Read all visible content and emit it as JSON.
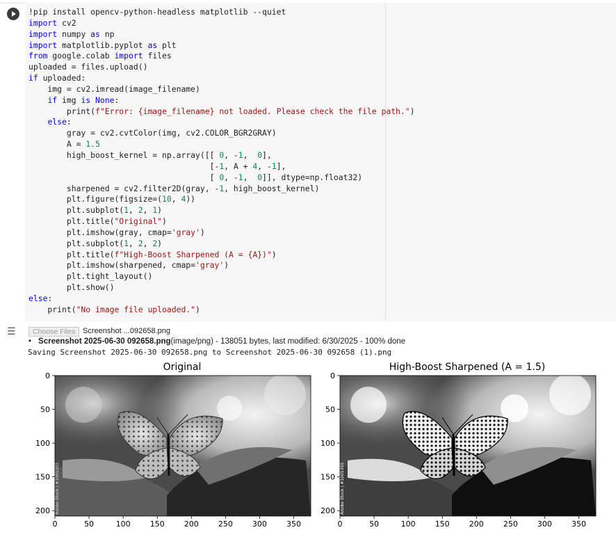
{
  "cell": {
    "code_lines": [
      "!pip install opencv-python-headless matplotlib --quiet",
      "import cv2",
      "import numpy as np",
      "import matplotlib.pyplot as plt",
      "from google.colab import files",
      "uploaded = files.upload()",
      "if uploaded:",
      "    img = cv2.imread(image_filename)",
      "    if img is None:",
      "        print(f\"Error: {image_filename} not loaded. Please check the file path.\")",
      "    else:",
      "        gray = cv2.cvtColor(img, cv2.COLOR_BGR2GRAY)",
      "        A = 1.5",
      "        high_boost_kernel = np.array([[ 0, -1,  0],",
      "                                      [-1, A + 4, -1],",
      "                                      [ 0, -1,  0]], dtype=np.float32)",
      "        sharpened = cv2.filter2D(gray, -1, high_boost_kernel)",
      "        plt.figure(figsize=(10, 4))",
      "        plt.subplot(1, 2, 1)",
      "        plt.title(\"Original\")",
      "        plt.imshow(gray, cmap='gray')",
      "        plt.subplot(1, 2, 2)",
      "        plt.title(f\"High-Boost Sharpened (A = {A})\")",
      "        plt.imshow(sharpened, cmap='gray')",
      "        plt.tight_layout()",
      "        plt.show()",
      "else:",
      "    print(\"No image file uploaded.\")"
    ]
  },
  "output": {
    "choose_files_label": "Choose Files",
    "chosen_file": "Screenshot ...092658.png",
    "upload_bullet": "•",
    "upload_filename": "Screenshot 2025-06-30 092658.png",
    "upload_details": "(image/png) - 138051 bytes, last modified: 6/30/2025 - 100% done",
    "saving_text": "Saving Screenshot 2025-06-30 092658.png to Screenshot 2025-06-30 092658 (1).png"
  },
  "figure": {
    "left_title": "Original",
    "right_title": "High-Boost Sharpened (A = 1.5)",
    "watermark": "Adobe Stock | #1005355"
  },
  "chart_data": [
    {
      "type": "image",
      "title": "Original",
      "x_ticks": [
        0,
        50,
        100,
        150,
        200,
        250,
        300,
        350
      ],
      "y_ticks": [
        0,
        50,
        100,
        150,
        200
      ],
      "xlim": [
        0,
        375
      ],
      "ylim": [
        208,
        0
      ]
    },
    {
      "type": "image",
      "title": "High-Boost Sharpened (A = 1.5)",
      "x_ticks": [
        0,
        50,
        100,
        150,
        200,
        250,
        300,
        350
      ],
      "y_ticks": [
        0,
        50,
        100,
        150,
        200
      ],
      "xlim": [
        0,
        375
      ],
      "ylim": [
        208,
        0
      ]
    }
  ],
  "colors": {
    "editor_bg": "#f7f7f7",
    "keyword": "#0000ff",
    "string": "#a31515",
    "number": "#098658"
  },
  "icons": {
    "run": "play-icon",
    "output": "output-toggle-icon"
  }
}
